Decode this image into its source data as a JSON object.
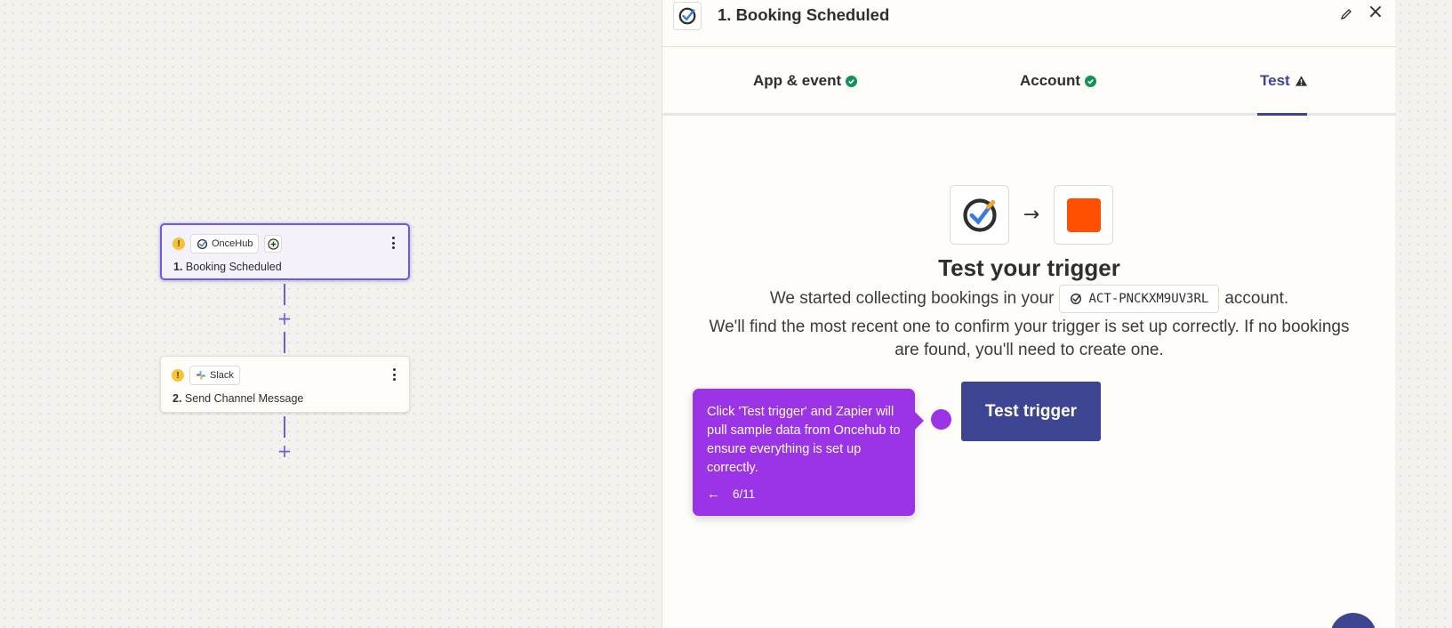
{
  "canvas": {
    "steps": [
      {
        "app": "OnceHub",
        "number": "1.",
        "title": "Booking Scheduled",
        "warning": "!"
      },
      {
        "app": "Slack",
        "number": "2.",
        "title": "Send Channel Message",
        "warning": "!"
      }
    ],
    "add_symbol": "+"
  },
  "panel": {
    "title": "1. Booking Scheduled",
    "tabs": [
      {
        "label": "App & event",
        "status": "complete"
      },
      {
        "label": "Account",
        "status": "complete"
      },
      {
        "label": "Test",
        "status": "warning",
        "active": true
      }
    ],
    "heading": "Test your trigger",
    "desc_before": "We started collecting bookings in your",
    "account_name": "ACT-PNCKXM9UV3RL",
    "desc_after": "account.",
    "desc_rest": "We'll find the most recent one to confirm your trigger is set up correctly. If no bookings are found, you'll need to create one.",
    "button_label": "Test trigger",
    "arrow": "→"
  },
  "tooltip": {
    "text": "Click 'Test trigger' and Zapier will pull sample data from Oncehub to ensure everything is set up correctly.",
    "back_arrow": "←",
    "progress": "6/11"
  },
  "colors": {
    "accent": "#695be8",
    "primary_button": "#3d4592",
    "tooltip": "#9b33e6",
    "success": "#13915a",
    "warning": "#f5c338",
    "orange_app": "#ff4f00"
  },
  "icons": {
    "oncehub": "oncehub-check-icon",
    "slack": "slack-icon",
    "edit": "pencil-icon",
    "close": "close-icon",
    "more": "kebab-icon"
  }
}
